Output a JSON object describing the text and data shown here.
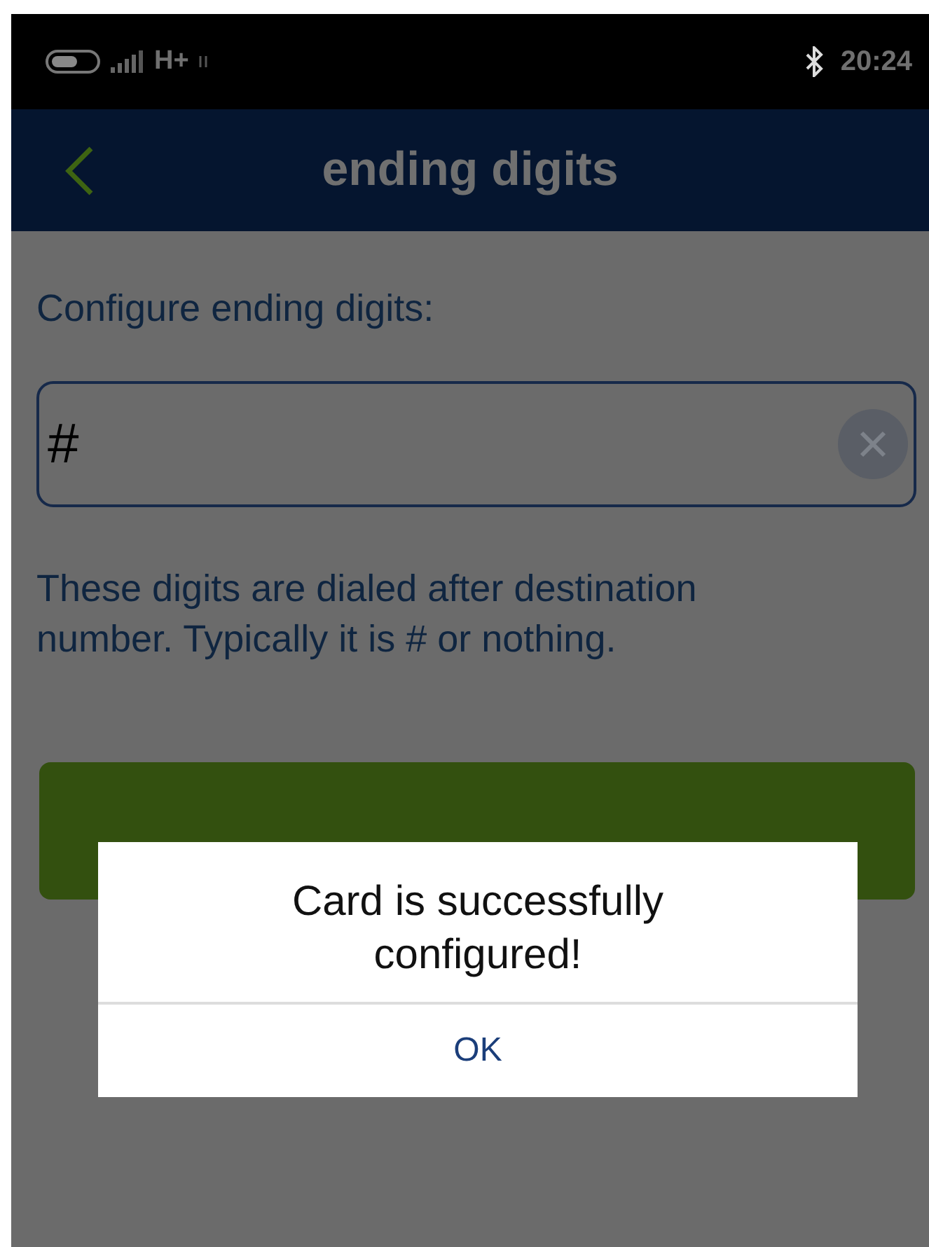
{
  "status_bar": {
    "network": "H+",
    "time": "20:24"
  },
  "app_bar": {
    "title": "ending digits"
  },
  "form": {
    "label": "Configure ending digits:",
    "input": {
      "value": "#"
    },
    "help": "These digits are dialed after destination number. Typically it is # or nothing."
  },
  "done_button": {
    "enabled": true
  },
  "dialog": {
    "message": "Card is successfully configured!",
    "buttons": [
      "OK"
    ]
  }
}
